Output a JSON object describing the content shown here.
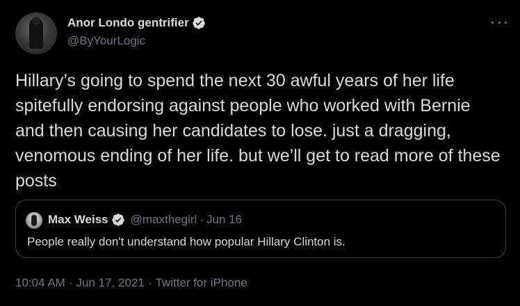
{
  "author": {
    "display_name": "Anor Londo gentrifier",
    "handle": "@ByYourLogic",
    "verified": true
  },
  "tweet": {
    "text": "Hillary’s going to spend the next 30 awful years of her life spitefully endorsing against people who worked with Bernie and then causing her candidates to lose. just a dragging, venomous ending of her life. but we’ll get to read more of these posts"
  },
  "quoted_tweet": {
    "display_name": "Max Weiss",
    "handle": "@maxthegirl",
    "separator": "·",
    "date": "Jun 16",
    "text": "People really don't understand how popular Hillary Clinton is."
  },
  "meta": {
    "time": "10:04 AM",
    "sep1": "·",
    "date": "Jun 17, 2021",
    "sep2": "·",
    "source": "Twitter for iPhone"
  },
  "icons": {
    "verified": "verified-badge-icon",
    "more": "more-options-icon"
  },
  "colors": {
    "background": "#000000",
    "primary_text": "#d9d9d9",
    "secondary_text": "#6e767d",
    "border": "#3d4145"
  }
}
